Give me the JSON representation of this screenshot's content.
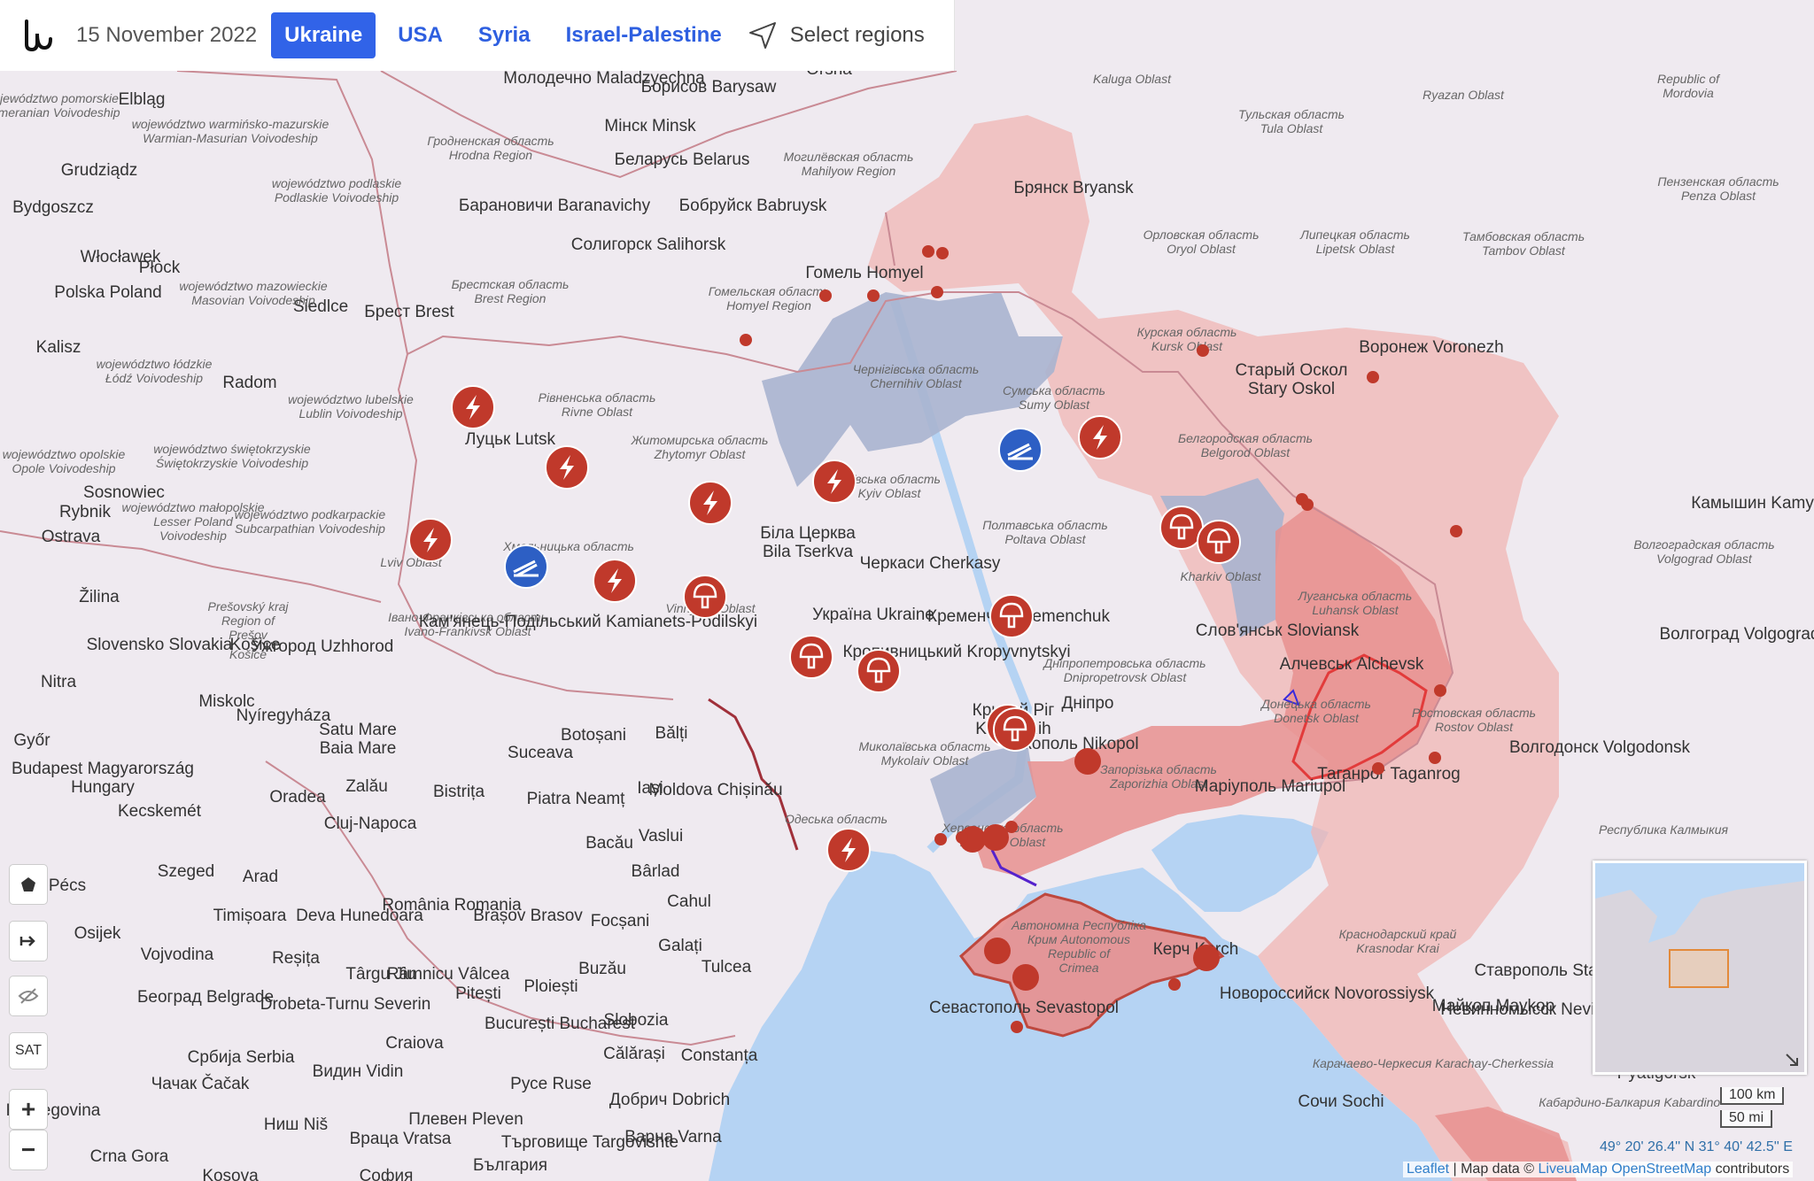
{
  "header": {
    "date": "15 November 2022",
    "tabs": [
      {
        "label": "Ukraine",
        "active": true
      },
      {
        "label": "USA",
        "active": false
      },
      {
        "label": "Syria",
        "active": false
      },
      {
        "label": "Israel-Palestine",
        "active": false
      }
    ],
    "select_regions": "Select regions"
  },
  "colors": {
    "occupied": "#e8908f",
    "russia": "#f0b6b4",
    "liberated": "#a8b4cf",
    "sea": "#b5d3f3",
    "land": "#efeaf0",
    "marker": "#c0392b",
    "marker_blue": "#2d5fc4"
  },
  "map_labels": {
    "olsztyn": "województwo warmińsko-mazurskie Warmian-Masurian Voivodeship",
    "bydgoszcz": "Bydgoszcz",
    "poland": "Polska Poland",
    "siedlce": "Siedlce",
    "brest": "Брест Brest",
    "minsk": "Мінск Minsk",
    "belarus": "Беларусь Belarus",
    "molodechno": "Молодечно Maladzyechna",
    "borisov": "Борисов Barysaw",
    "babruysk": "Бобруйск Babruysk",
    "baranavichy": "Барановичи Baranavichy",
    "salihorsk": "Солигорск Salihorsk",
    "homyel": "Гомель Homyel",
    "bryansk": "Брянск Bryansk",
    "kaluga": "Kaluga Oblast",
    "tula": "Тульская область Tula Oblast",
    "ryazan": "Ryazan Oblast",
    "mordovia": "Republic of Mordovia",
    "oryol": "Орловская область Oryol Oblast",
    "lipetsk": "Липецкая область Lipetsk Oblast",
    "tambov": "Тамбовская область Tambov Oblast",
    "penza": "Пензенская область Penza Oblast",
    "kursk": "Курская область Kursk Oblast",
    "voronezh": "Воронеж Voronezh",
    "stary_oskol": "Старый Оскол Stary Oskol",
    "belgorod": "Белгородская область Belgorod Oblast",
    "kamyshin": "Камышин Kamyshin",
    "volgograd_obl": "Волгоградская область Volgograd Oblast",
    "volgograd": "Волгоград Volgograd",
    "lutsk": "Луцьк Lutsk",
    "rivne": "Рівненська область Rivne Oblast",
    "zhytomyr": "Житомирська область Zhytomyr Oblast",
    "kyiv": "Київська область Kyiv Oblast",
    "chernihiv": "Чернігівська область Chernihiv Oblast",
    "sumy": "Сумська область Sumy Oblast",
    "poltava": "Полтавська область Poltava Oblast",
    "kharkiv": "Kharkiv Oblast",
    "bila_tserkva": "Біла Церква Bila Tserkva",
    "cherkasy": "Черкаси Cherkasy",
    "ukraine": "Україна Ukraine",
    "kropyvnytskyi": "Кропивницький Kropyvnytskyi",
    "vinnytsia": "Vinnytsia Oblast",
    "lviv": "Lviv Oblast",
    "ivano": "Івано-Франківська область Ivano-Frankivsk Oblast",
    "kamianets": "Кам'янець-Подільський Kamianets-Podilskyi",
    "khmelnytskyi": "Хмельницька область",
    "dnipro": "Дніпропетровська область Dnipropetrovsk Oblast",
    "kryvyi_rih": "Кривий Ріг Kryvyi Rih",
    "kremenchuk": "Кременчук Kremenchuk",
    "nikopol": "Нікополь Nikopol",
    "zaporizhia": "Запорізька область Zaporizhia Oblast",
    "mykolaiv": "Миколаївська область Mykolaiv Oblast",
    "odesa": "Одеська область",
    "kherson": "Херсонська область Kherson Oblast",
    "crimea": "Автономна Республіка Крим Autonomous Republic of Crimea",
    "sevastopol": "Севастополь Sevastopol",
    "kerch": "Керч Kerch",
    "mariupol": "Маріуполь Mariupol",
    "taganrog": "Таганрог Taganrog",
    "donetsk": "Донецька область Donetsk Oblast",
    "luhansk": "Луганська область Luhansk Oblast",
    "alchevsk": "Алчевськ Alchevsk",
    "sloviansk": "Слов'янськ Sloviansk",
    "rostov": "Ростовская область Rostov Oblast",
    "volgodonsk": "Волгодонск Volgodonsk",
    "krasnodar": "Краснодарский край Krasnodar Krai",
    "novorossiysk": "Новороссийск Novorossiysk",
    "maykop": "Майкоп Maykop",
    "stavropol": "Ставрополь Stavropol",
    "nevinnomyssk": "Невинномысск Nevinnomyssk",
    "kalmykia": "Республика Калмыкия",
    "karachay": "Карачаево-Черкесия Karachay-Cherkessia",
    "pyatigorsk": "Pyatigorsk",
    "kabardino": "Кабардино-Балкария Kabardino-",
    "sochi": "Сочи Sochi",
    "moldova": "Moldova Chișinău",
    "iasi": "Iași",
    "balti": "Bălți",
    "botosani": "Botoșani",
    "suceava": "Suceava",
    "piatra": "Piatra Neamț",
    "bacau": "Bacău",
    "vaslui": "Vaslui",
    "barlad": "Bârlad",
    "cahul": "Cahul",
    "galati": "Galați",
    "focsani": "Focșani",
    "tulcea": "Tulcea",
    "buzau": "Buzău",
    "romania": "România Romania",
    "brasov": "Brașov Brasov",
    "ploiesti": "Ploiești",
    "bucuresti": "București Bucharest",
    "constanta": "Constanța",
    "slobozia": "Slobozia",
    "calarasi": "Călărași",
    "cluj": "Cluj-Napoca",
    "bistrita": "Bistrița",
    "zalau": "Zalău",
    "baia_mare": "Satu Mare Baia Mare",
    "oradea": "Oradea",
    "arad": "Arad",
    "timisoara": "Timișoara",
    "deva": "Deva Hunedoara",
    "resita": "Reșița",
    "targu_jiu": "Târgu Jiu",
    "ramnicu": "Râmnicu Vâlcea",
    "pitesti": "Pitești",
    "craiova": "Craiova",
    "drobeta": "Drobeta-Turnu Severin",
    "hungary": "Budapest Magyarország Hungary",
    "kecskemet": "Kecskemét",
    "szeged": "Szeged",
    "pecs": "Pécs",
    "osijek": "Osijek",
    "nyiregyhaza": "Nyíregyháza",
    "miskolc": "Miskolc",
    "gyor": "Győr",
    "slovakia": "Slovensko Slovakia",
    "kosice": "Košice",
    "uzhhorod": "Ужгород Uzhhorod",
    "nitra": "Nitra",
    "zilina": "Žilina",
    "ostrava": "Ostrava",
    "beograd": "Београд Belgrade",
    "serbia": "Србија Serbia",
    "vojvodina": "Vojvodina",
    "nis": "Ниш Niš",
    "vidin": "Видин Vidin",
    "pleven": "Плевен Pleven",
    "ruse": "Русе Ruse",
    "targovishte": "Търговище Targovishte",
    "dobrich": "Добрич Dobrich",
    "varna": "Варна Varna",
    "bulgaria": "България",
    "vratsa": "Враца Vratsa",
    "sofia": "София",
    "kosova": "Kosova",
    "crna_gora": "Crna Gora",
    "cacak": "Чачак Čačak",
    "herzegovina": "Herzegovina",
    "elblag": "Elbląg",
    "grudziadz": "Grudziądz",
    "plock": "Płock",
    "wloclawek": "Włocławek",
    "kalisz": "Kalisz",
    "lodz": "województwo łódzkie Łódź Voivodeship",
    "radom": "Radom",
    "lublin": "województwo lubelskie Lublin Voivodeship",
    "podkarpackie": "województwo podkarpackie Subcarpathian Voivodeship",
    "malopolskie": "województwo małopolskie Lesser Poland Voivodeship",
    "swietokrzyskie": "województwo świętokrzyskie Świętokrzyskie Voivodeship",
    "opole": "województwo opolskie Opole Voivodeship",
    "rybnik": "Rybnik",
    "sosnowiec": "Sosnowiec",
    "presov": "Prešovský kraj Region of Prešov",
    "podlaskie": "województwo podlaskie Podlaskie Voivodeship",
    "mazowieckie": "województwo mazowieckie Masovian Voivodeship",
    "pomorskie": "województwo pomorskie Pomeranian Voivodeship",
    "grodno": "Гродненская область Hrodna Region",
    "brestreg": "Брестская область Brest Region",
    "homyelreg": "Гомельская область Homyel Region",
    "mahilyow": "Могилёвская область Mahilyow Region",
    "orsha": "Orsha",
    "dnipro_city": "Дніпро",
    "kosice_reg": "Košice"
  },
  "markers": [
    {
      "icon": "explosion"
    },
    {
      "icon": "explosion"
    },
    {
      "icon": "explosion"
    },
    {
      "icon": "explosion"
    },
    {
      "icon": "explosion"
    },
    {
      "icon": "explosion"
    },
    {
      "icon": "explosion"
    },
    {
      "icon": "explosion"
    },
    {
      "icon": "rocket"
    },
    {
      "icon": "rocket"
    },
    {
      "icon": "mushroom"
    },
    {
      "icon": "mushroom"
    },
    {
      "icon": "mushroom"
    },
    {
      "icon": "mushroom"
    },
    {
      "icon": "mushroom"
    },
    {
      "icon": "mushroom"
    },
    {
      "icon": "mushroom"
    },
    {
      "icon": "mushroom"
    }
  ],
  "controls": {
    "sat_label": "SAT",
    "zoom_in": "+",
    "zoom_out": "−"
  },
  "scale": {
    "km": "100 km",
    "mi": "50 mi"
  },
  "coordinates": "49° 20' 26.4'' N 31° 40' 42.5'' E",
  "attribution": {
    "leaflet": "Leaflet",
    "map_data": " | Map data © ",
    "liveuamap": "LiveuaMap",
    "osm": "OpenStreetMap",
    "contributors": " contributors"
  }
}
